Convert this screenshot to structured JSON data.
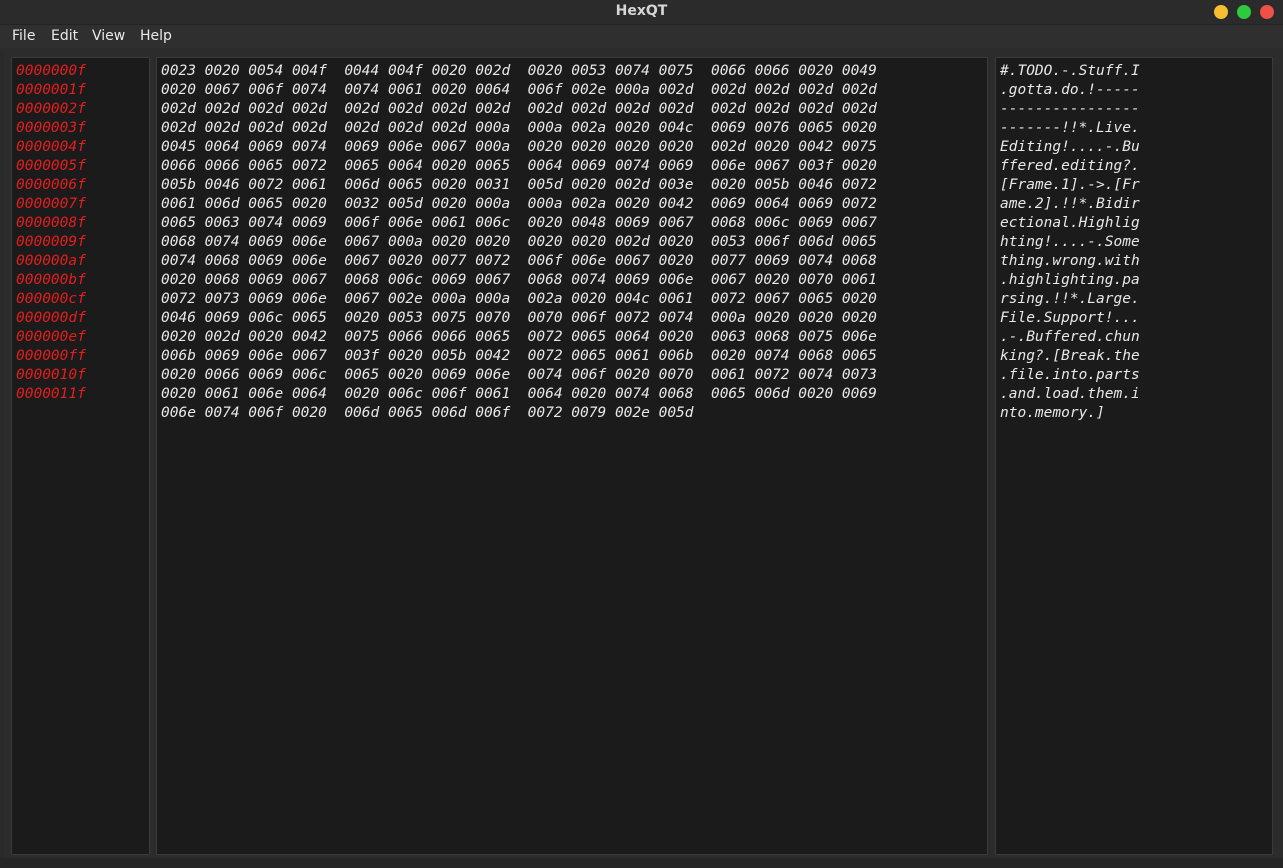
{
  "window": {
    "title": "HexQT",
    "controls": {
      "minimize_color": "#f5bf2f",
      "maximize_color": "#2ec93f",
      "close_color": "#f0504a"
    }
  },
  "menu": [
    "File",
    "Edit",
    "View",
    "Help"
  ],
  "colors": {
    "address_text": "#e41e1e",
    "hex_text": "#e8e8e8",
    "panel_bg": "#1b1b1b",
    "window_bg": "#2c2c2c"
  },
  "addresses": [
    "0000000f",
    "0000001f",
    "0000002f",
    "0000003f",
    "0000004f",
    "0000005f",
    "0000006f",
    "0000007f",
    "0000008f",
    "0000009f",
    "000000af",
    "000000bf",
    "000000cf",
    "000000df",
    "000000ef",
    "000000ff",
    "0000010f",
    "0000011f"
  ],
  "hex_lines": [
    "0023 0020 0054 004f  0044 004f 0020 002d  0020 0053 0074 0075  0066 0066 0020 0049",
    "0020 0067 006f 0074  0074 0061 0020 0064  006f 002e 000a 002d  002d 002d 002d 002d",
    "002d 002d 002d 002d  002d 002d 002d 002d  002d 002d 002d 002d  002d 002d 002d 002d",
    "002d 002d 002d 002d  002d 002d 002d 000a  000a 002a 0020 004c  0069 0076 0065 0020",
    "0045 0064 0069 0074  0069 006e 0067 000a  0020 0020 0020 0020  002d 0020 0042 0075",
    "0066 0066 0065 0072  0065 0064 0020 0065  0064 0069 0074 0069  006e 0067 003f 0020",
    "005b 0046 0072 0061  006d 0065 0020 0031  005d 0020 002d 003e  0020 005b 0046 0072",
    "0061 006d 0065 0020  0032 005d 0020 000a  000a 002a 0020 0042  0069 0064 0069 0072",
    "0065 0063 0074 0069  006f 006e 0061 006c  0020 0048 0069 0067  0068 006c 0069 0067",
    "0068 0074 0069 006e  0067 000a 0020 0020  0020 0020 002d 0020  0053 006f 006d 0065",
    "0074 0068 0069 006e  0067 0020 0077 0072  006f 006e 0067 0020  0077 0069 0074 0068",
    "0020 0068 0069 0067  0068 006c 0069 0067  0068 0074 0069 006e  0067 0020 0070 0061",
    "0072 0073 0069 006e  0067 002e 000a 000a  002a 0020 004c 0061  0072 0067 0065 0020",
    "0046 0069 006c 0065  0020 0053 0075 0070  0070 006f 0072 0074  000a 0020 0020 0020",
    "0020 002d 0020 0042  0075 0066 0066 0065  0072 0065 0064 0020  0063 0068 0075 006e",
    "006b 0069 006e 0067  003f 0020 005b 0042  0072 0065 0061 006b  0020 0074 0068 0065",
    "0020 0066 0069 006c  0065 0020 0069 006e  0074 006f 0020 0070  0061 0072 0074 0073",
    "0020 0061 006e 0064  0020 006c 006f 0061  0064 0020 0074 0068  0065 006d 0020 0069",
    "006e 0074 006f 0020  006d 0065 006d 006f  0072 0079 002e 005d"
  ],
  "ascii_lines": [
    "#.TODO.-.Stuff.I",
    ".gotta.do.!-----",
    "----------------",
    "-------!!*.Live.",
    "Editing!....-.Bu",
    "ffered.editing?.",
    "[Frame.1].->.[Fr",
    "ame.2].!!*.Bidir",
    "ectional.Highlig",
    "hting!....-.Some",
    "thing.wrong.with",
    ".highlighting.pa",
    "rsing.!!*.Large.",
    "File.Support!...",
    ".-.Buffered.chun",
    "king?.[Break.the",
    ".file.into.parts",
    ".and.load.them.i",
    "nto.memory.]"
  ]
}
